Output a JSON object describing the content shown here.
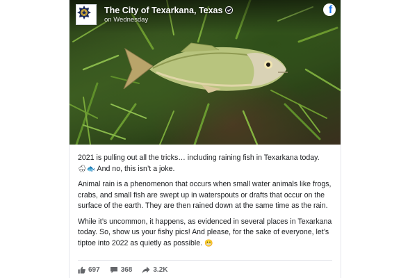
{
  "post": {
    "page_name": "The City of Texarkana, Texas",
    "timestamp": "on Wednesday",
    "paragraphs": {
      "p1_line1": "2021 is pulling out all the tricks… including raining fish in Texarkana today.",
      "p1_emoji": "🌧🐟",
      "p1_line2": "And no, this isn’t a joke.",
      "p2": "Animal rain is a phenomenon that occurs when small water animals like frogs, crabs, and small fish are swept up in waterspouts or drafts that occur on the surface of the earth. They are then rained down at the same time as the rain.",
      "p3": "While it’s uncommon, it happens, as evidenced in several places in Texarkana today. So, show us your fishy pics! And please, for the sake of everyone, let’s tiptoe into 2022 as quietly as possible.",
      "p3_emoji": "😬"
    },
    "stats": {
      "likes": "697",
      "comments": "368",
      "shares": "3.2K"
    }
  },
  "icons": {
    "avatar": "police-badge-icon",
    "verified": "verified-badge-icon",
    "brand": "facebook-logo-icon",
    "like": "thumbs-up-icon",
    "comment": "comment-icon",
    "share": "share-arrow-icon"
  },
  "colors": {
    "facebook_blue": "#1877f2",
    "text": "#1c1e21",
    "muted": "#65676b"
  }
}
